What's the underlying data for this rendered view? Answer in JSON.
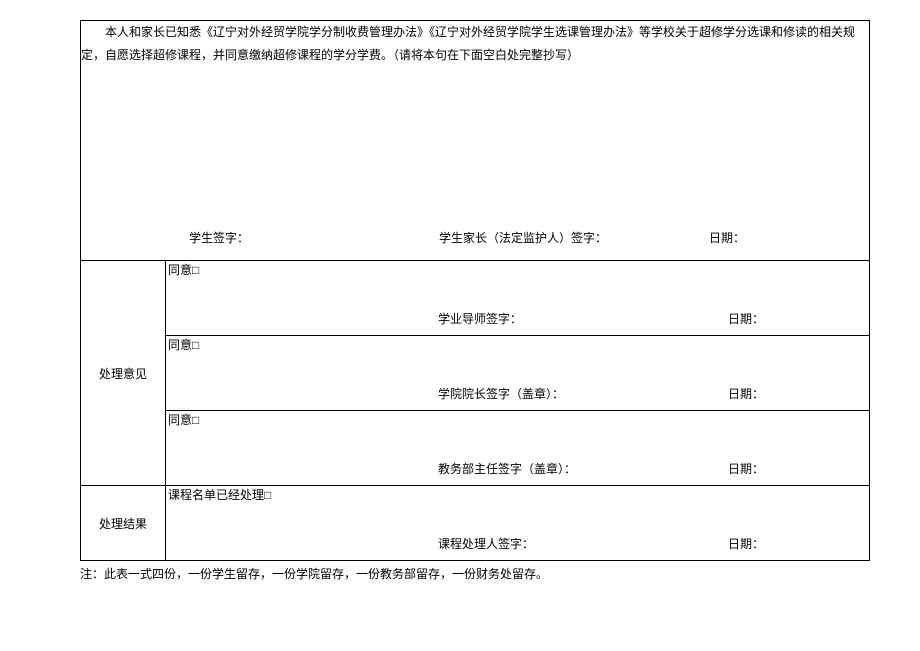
{
  "declaration": {
    "text": "本人和家长已知悉《辽宁对外经贸学院学分制收费管理办法》《辽宁对外经贸学院学生选课管理办法》等学校关于超修学分选课和修读的相关规定，自愿选择超修课程，并同意缴纳超修课程的学分学费。（请将本句在下面空白处完整抄写）",
    "student_sig_label": "学生签字：",
    "guardian_sig_label": "学生家长（法定监护人）签字：",
    "date_label": "日期："
  },
  "opinion": {
    "label": "处理意见",
    "agree_label": "同意□",
    "advisor_sig_label": "学业导师签字：",
    "dean_sig_label": "学院院长签字（盖章）：",
    "director_sig_label": "教务部主任签字（盖章）：",
    "date_label": "日期："
  },
  "result": {
    "label": "处理结果",
    "processed_label": "课程名单已经处理□",
    "processor_sig_label": "课程处理人签字：",
    "date_label": "日期："
  },
  "footnote": "注：此表一式四份，一份学生留存，一份学院留存，一份教务部留存，一份财务处留存。"
}
